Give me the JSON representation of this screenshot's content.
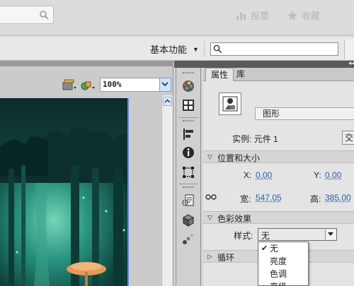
{
  "browser": {
    "link_a": "投票",
    "link_b": "收藏"
  },
  "menubar": {
    "workspace_label": "基本功能",
    "search_placeholder": ""
  },
  "stage": {
    "zoom_value": "100%"
  },
  "panel": {
    "tabs": [
      {
        "label": "属性",
        "active": true
      },
      {
        "label": "库",
        "active": false
      }
    ],
    "symbol_type": "图形",
    "instance_label": "实例:",
    "instance_name": "元件 1",
    "swap_label": "交",
    "position_section": "位置和大小",
    "x_label": "X:",
    "x_value": "0.00",
    "y_label": "Y:",
    "y_value": "0.00",
    "width_label": "宽:",
    "width_value": "547.05",
    "height_label": "高:",
    "height_value": "385.00",
    "color_section": "色彩效果",
    "style_label": "样式:",
    "style_value": "无",
    "loop_section": "循环",
    "style_options": [
      {
        "label": "无",
        "selected": true
      },
      {
        "label": "亮度",
        "selected": false
      },
      {
        "label": "色调",
        "selected": false
      },
      {
        "label": "高级",
        "selected": false
      }
    ]
  },
  "colors": {
    "link_blue": "#2a5db0",
    "panel_bg": "#e4e4e4",
    "canvas_teal": "#0a3a34"
  }
}
